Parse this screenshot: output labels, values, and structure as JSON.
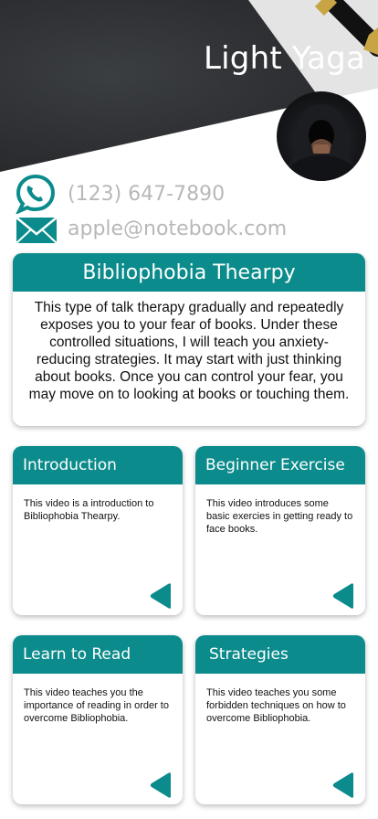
{
  "profile": {
    "name": "Light Yaga",
    "phone": "(123) 647-7890",
    "email": "apple@notebook.com"
  },
  "feature": {
    "title": "Bibliophobia Thearpy",
    "description": "This type of talk therapy gradually and repeatedly exposes you to your fear of books. Under these controlled situations, I will teach you anxiety-reducing strategies. It may start with just thinking about books. Once you can control your fear, you may move on to looking at books or touching them."
  },
  "videos": [
    {
      "title": "Introduction",
      "description": "This video is a introduction to Bibliophobia Thearpy."
    },
    {
      "title": "Beginner Exercise",
      "description": "This video introduces some basic exercies in getting ready to face books."
    },
    {
      "title": "Learn to Read",
      "description": "This video teaches you the importance of reading in order to overcome Bibliophobia."
    },
    {
      "title": "Strategies",
      "description": "This video teaches you some forbidden techniques on how to overcome Bibliophobia."
    }
  ],
  "colors": {
    "accent": "#0b8b8b",
    "header_dark": "#2a2c2f",
    "contact_text": "#b8b8b8"
  },
  "icons": {
    "phone": "phone-icon",
    "email": "envelope-icon",
    "play": "play-triangle-icon"
  }
}
